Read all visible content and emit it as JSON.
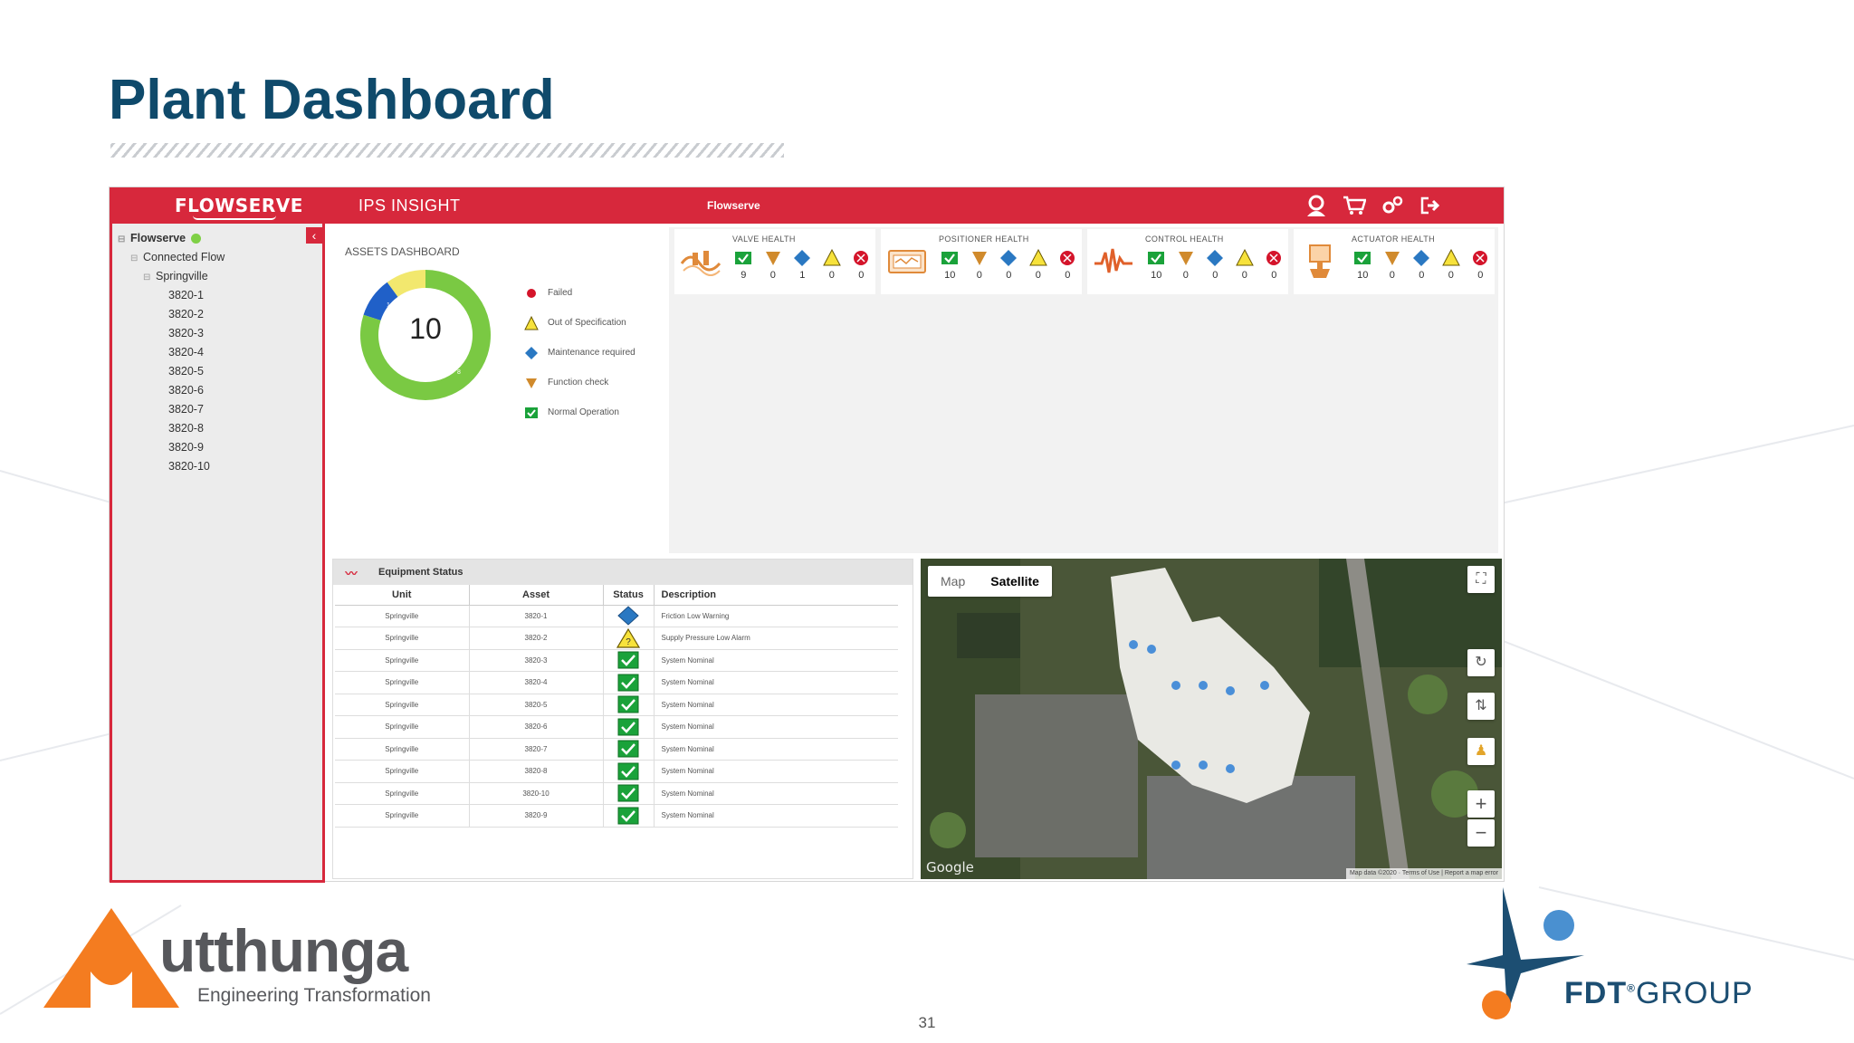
{
  "slide": {
    "title": "Plant Dashboard",
    "page_number": "31"
  },
  "header": {
    "brand": "FLOWSERVE",
    "app_name": "IPS INSIGHT",
    "company": "Flowserve",
    "icons": [
      "user-icon",
      "cart-icon",
      "settings-icon",
      "logout-icon"
    ]
  },
  "sidebar": {
    "root": "Flowserve",
    "group": "Connected Flow",
    "site": "Springville",
    "assets": [
      "3820-1",
      "3820-2",
      "3820-3",
      "3820-4",
      "3820-5",
      "3820-6",
      "3820-7",
      "3820-8",
      "3820-9",
      "3820-10"
    ],
    "collapse_icon": "chevron-left-icon"
  },
  "assets_dashboard": {
    "title": "ASSETS DASHBOARD",
    "total": "10",
    "segments": [
      {
        "label": "Normal Operation",
        "value": 8,
        "color": "#7ac943"
      },
      {
        "label": "Maintenance required",
        "value": 1,
        "color": "#2060c8"
      },
      {
        "label": "Out of Specification",
        "value": 1,
        "color": "#f2e86e"
      }
    ],
    "segment_labels": {
      "maintenance": "1",
      "normal": "8"
    },
    "legend": [
      "Failed",
      "Out of Specification",
      "Maintenance required",
      "Function check",
      "Normal Operation"
    ]
  },
  "health_cards": [
    {
      "title": "VALVE HEALTH",
      "icon": "valve-icon",
      "counts": [
        "9",
        "0",
        "1",
        "0",
        "0"
      ]
    },
    {
      "title": "POSITIONER HEALTH",
      "icon": "positioner-icon",
      "counts": [
        "10",
        "0",
        "0",
        "0",
        "0"
      ]
    },
    {
      "title": "CONTROL HEALTH",
      "icon": "control-wave-icon",
      "counts": [
        "10",
        "0",
        "0",
        "0",
        "0"
      ]
    },
    {
      "title": "ACTUATOR HEALTH",
      "icon": "actuator-icon",
      "counts": [
        "10",
        "0",
        "0",
        "0",
        "0"
      ]
    }
  ],
  "equipment_status": {
    "title": "Equipment Status",
    "columns": [
      "Unit",
      "Asset",
      "Status",
      "Description"
    ],
    "rows": [
      {
        "unit": "Springville",
        "asset": "3820-1",
        "status": "maintenance",
        "description": "Friction Low Warning"
      },
      {
        "unit": "Springville",
        "asset": "3820-2",
        "status": "out-of-spec",
        "description": "Supply Pressure Low Alarm"
      },
      {
        "unit": "Springville",
        "asset": "3820-3",
        "status": "normal",
        "description": "System Nominal"
      },
      {
        "unit": "Springville",
        "asset": "3820-4",
        "status": "normal",
        "description": "System Nominal"
      },
      {
        "unit": "Springville",
        "asset": "3820-5",
        "status": "normal",
        "description": "System Nominal"
      },
      {
        "unit": "Springville",
        "asset": "3820-6",
        "status": "normal",
        "description": "System Nominal"
      },
      {
        "unit": "Springville",
        "asset": "3820-7",
        "status": "normal",
        "description": "System Nominal"
      },
      {
        "unit": "Springville",
        "asset": "3820-8",
        "status": "normal",
        "description": "System Nominal"
      },
      {
        "unit": "Springville",
        "asset": "3820-10",
        "status": "normal",
        "description": "System Nominal"
      },
      {
        "unit": "Springville",
        "asset": "3820-9",
        "status": "normal",
        "description": "System Nominal"
      }
    ]
  },
  "map": {
    "tab_map": "Map",
    "tab_satellite": "Satellite",
    "google": "Google",
    "attribution": "Map data ©2020 · Terms of Use | Report a map error",
    "controls": [
      "fullscreen-icon",
      "rotate-icon",
      "tilt-icon",
      "pegman-icon",
      "zoom-in-icon",
      "zoom-out-icon"
    ],
    "zoom_in": "+",
    "zoom_out": "−"
  },
  "footer": {
    "left_logo_word": "utthunga",
    "left_logo_tagline": "Engineering Transformation",
    "right_logo_word": "FDT",
    "right_logo_reg": "®",
    "right_logo_group": "GROUP"
  },
  "colors": {
    "accent_red": "#d7283c",
    "title_blue": "#0f4a6b",
    "normal_green": "#1aa23a",
    "warning_yellow": "#f7e23b",
    "maintenance_blue": "#2a78c2",
    "function_check_orange": "#d08a2c",
    "failed_red": "#d4142a"
  }
}
